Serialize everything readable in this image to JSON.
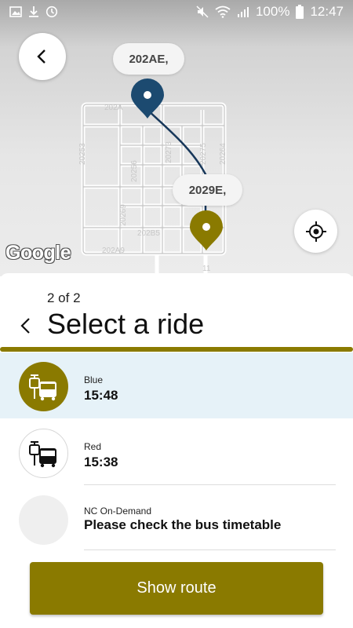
{
  "status_bar": {
    "battery": "100%",
    "time": "12:47"
  },
  "map": {
    "marker_labels": [
      "202AE,",
      "2029E,"
    ],
    "street_labels": [
      "202A",
      "20253",
      "20256",
      "20273",
      "20275",
      "20269",
      "202B5",
      "202A9",
      "20264",
      "11"
    ],
    "attribution": "Google",
    "origin_marker_color": "#1c4a70",
    "destination_marker_color": "#8a7a00",
    "route_color": "#17375a"
  },
  "sheet": {
    "step": "2 of 2",
    "title": "Select a ride",
    "accent_color": "#8a7a00",
    "rides": [
      {
        "name": "Blue",
        "time": "15:48",
        "icon": "bus-stop-icon",
        "selected": true
      },
      {
        "name": "Red",
        "time": "15:38",
        "icon": "bus-stop-icon",
        "selected": false
      },
      {
        "name": "NC On-Demand",
        "time": "Please check the bus timetable",
        "icon": "blank",
        "selected": false
      }
    ],
    "show_route_label": "Show route"
  }
}
